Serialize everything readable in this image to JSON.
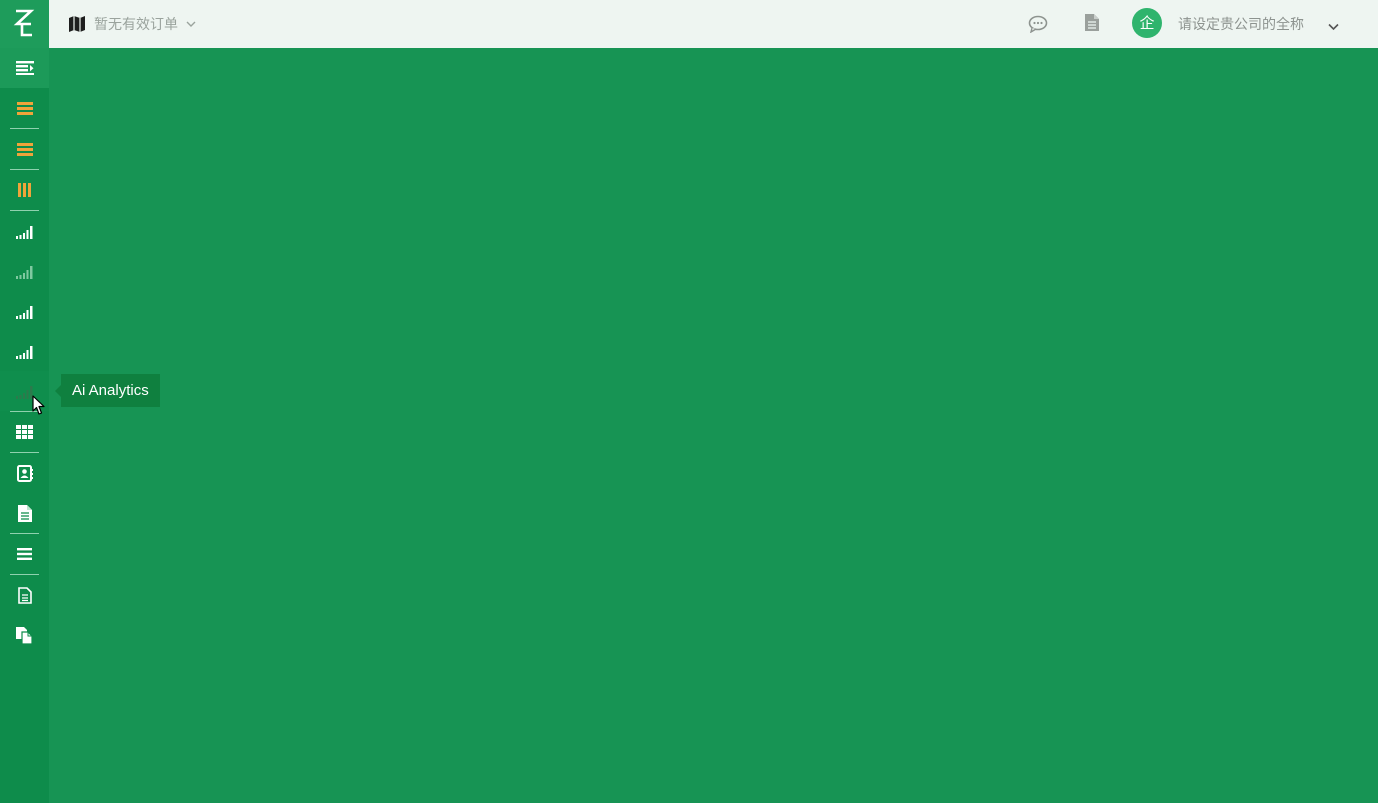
{
  "app": {
    "logo_icon": "zc-logo-icon"
  },
  "header": {
    "order_icon": "map-icon",
    "order_label": "暂无有效订单",
    "message_icon": "chat-icon",
    "document_icon": "document-icon",
    "avatar_text": "企",
    "company_name": "请设定贵公司的全称",
    "company_menu_icon": "chevron-down-icon"
  },
  "sidebar": {
    "items": [
      {
        "icon": "collapse-menu-icon",
        "color": "#ffffff"
      },
      {
        "icon": "list-icon",
        "color": "#f0a43a"
      },
      {
        "icon": "list-icon",
        "color": "#f0a43a"
      },
      {
        "icon": "columns-icon",
        "color": "#f0a43a"
      },
      {
        "icon": "signal-bars-icon",
        "color": "#ffffff"
      },
      {
        "icon": "signal-bars-icon",
        "color": "#7fc9a0"
      },
      {
        "icon": "signal-bars-icon",
        "color": "#ffffff"
      },
      {
        "icon": "signal-bars-icon",
        "color": "#ffffff"
      },
      {
        "icon": "signal-bars-icon",
        "color": "#2c7a4c"
      },
      {
        "icon": "grid-icon",
        "color": "#ffffff"
      },
      {
        "icon": "contact-book-icon",
        "color": "#ffffff"
      },
      {
        "icon": "document-icon",
        "color": "#ffffff"
      },
      {
        "icon": "menu-icon",
        "color": "#ffffff"
      },
      {
        "icon": "document-outline-icon",
        "color": "#ffffff"
      },
      {
        "icon": "copy-document-icon",
        "color": "#ffffff"
      }
    ]
  },
  "tooltip": {
    "text": "Ai Analytics"
  },
  "colors": {
    "main_background": "#179454",
    "sidebar_background": "#0e8c4b",
    "topbar_background": "#eef5f1",
    "accent_orange": "#f0a43a",
    "avatar_green": "#2fb46d"
  }
}
